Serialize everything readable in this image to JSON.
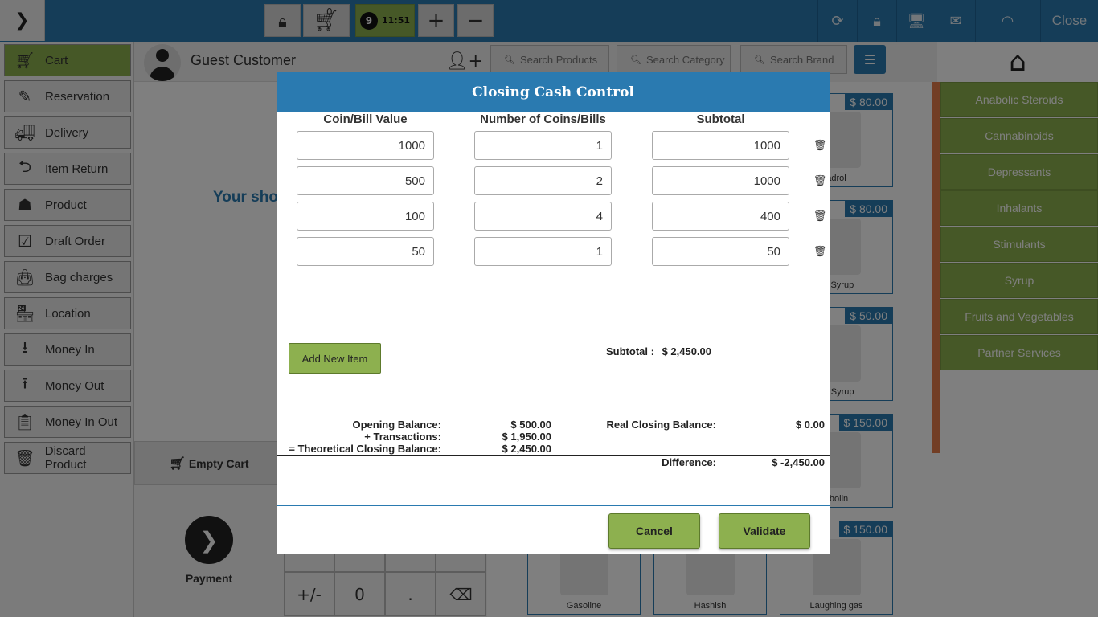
{
  "topbar": {
    "cart_count": "0",
    "clock_badge": "9",
    "clock_time": "11:51",
    "plus_label": "+",
    "minus_label": "−",
    "close_label": "Close"
  },
  "sidebar": {
    "items": [
      {
        "label": "Cart",
        "icon": "cart-icon"
      },
      {
        "label": "Reservation",
        "icon": "reservation-icon"
      },
      {
        "label": "Delivery",
        "icon": "delivery-truck-icon"
      },
      {
        "label": "Item Return",
        "icon": "item-return-icon"
      },
      {
        "label": "Product",
        "icon": "product-icon"
      },
      {
        "label": "Draft Order",
        "icon": "draft-order-icon"
      },
      {
        "label": "Bag charges",
        "icon": "bag-icon"
      },
      {
        "label": "Location",
        "icon": "store-icon"
      },
      {
        "label": "Money In",
        "icon": "money-in-icon"
      },
      {
        "label": "Money Out",
        "icon": "money-out-icon"
      },
      {
        "label": "Money In Out",
        "icon": "money-in-out-icon"
      },
      {
        "label": "Discard Product",
        "icon": "trash-icon"
      }
    ]
  },
  "cart": {
    "customer_name": "Guest Customer",
    "shop_message": "Your shop",
    "empty_cart_label": "Empty Cart",
    "payment_label": "Payment"
  },
  "keypad": {
    "keys": [
      "+/-",
      "0",
      ".",
      "⌫"
    ]
  },
  "search": {
    "products_placeholder": "Search Products",
    "category_placeholder": "Search Category",
    "brand_placeholder": "Search Brand"
  },
  "products": [
    {
      "price": "$ 80.00",
      "name": "adrol"
    },
    {
      "price": "$ 80.00",
      "name": "ryl Syrup"
    },
    {
      "price": "$ 50.00",
      "name": "gh Syrup"
    },
    {
      "price": "$ 150.00",
      "name": "abolin"
    },
    {
      "price": "$ 150.00",
      "name": "Laughing gas"
    },
    {
      "price": "",
      "name": "Gasoline"
    },
    {
      "price": "",
      "name": "Hashish"
    }
  ],
  "categories": [
    "Anabolic Steroids",
    "Cannabinoids",
    "Depressants",
    "Inhalants",
    "Stimulants",
    "Syrup",
    "Fruits and Vegetables",
    "Partner Services"
  ],
  "modal": {
    "title": "Closing Cash Control",
    "col_value": "Coin/Bill Value",
    "col_count": "Number of Coins/Bills",
    "col_subtotal": "Subtotal",
    "rows": [
      {
        "value": "1000",
        "count": "1",
        "subtotal": "1000"
      },
      {
        "value": "500",
        "count": "2",
        "subtotal": "1000"
      },
      {
        "value": "100",
        "count": "4",
        "subtotal": "400"
      },
      {
        "value": "50",
        "count": "1",
        "subtotal": "50"
      }
    ],
    "add_item_label": "Add New Item",
    "subtotal_label": "Subtotal :",
    "subtotal_value": "$ 2,450.00",
    "opening_balance_label": "Opening Balance:",
    "opening_balance_value": "$ 500.00",
    "transactions_label": "+ Transactions:",
    "transactions_value": "$ 1,950.00",
    "theoretical_label": "= Theoretical Closing Balance:",
    "theoretical_value": "$ 2,450.00",
    "real_closing_label": "Real Closing Balance:",
    "real_closing_value": "$ 0.00",
    "difference_label": "Difference:",
    "difference_value": "$ -2,450.00",
    "cancel_label": "Cancel",
    "validate_label": "Validate"
  },
  "colors": {
    "accent_blue": "#2a7ab0",
    "accent_green": "#8db04f",
    "accent_orange": "#e47d4a"
  }
}
